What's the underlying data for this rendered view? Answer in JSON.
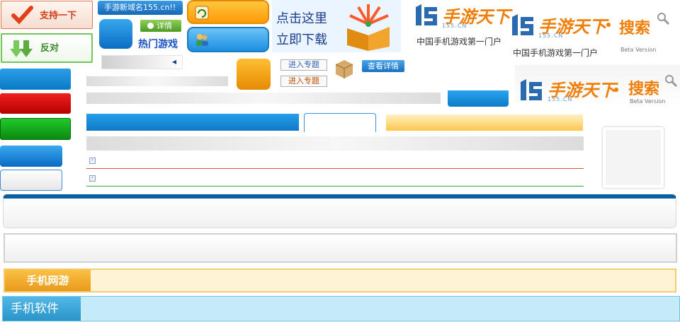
{
  "votes": {
    "support_label": "支持一下",
    "oppose_label": "反对"
  },
  "promo": {
    "domain_text": "手游新域名155.cn!!",
    "detail_label": "详情",
    "hot_games_label": "热门游戏",
    "download_line1": "点击这里",
    "download_line2": "立即下载"
  },
  "topics": {
    "enter_topic_1": "进入专题",
    "enter_topic_2": "进入专题",
    "view_detail": "查看详情"
  },
  "brand": {
    "logo_main": "手游天下",
    "logo_domain": "155.CN",
    "portal_caption": "中国手机游戏第一门户",
    "search_label": "搜索",
    "beta_label": "Beta Version"
  },
  "categories": {
    "mobile_online_games": "手机网游",
    "mobile_software": "手机软件"
  },
  "colors": {
    "accent_blue": "#1079c9",
    "accent_orange": "#f07f0a",
    "success_green": "#0a8a10",
    "danger_red": "#b50000"
  },
  "icons": [
    "checkmark-icon",
    "down-arrows-icon",
    "refresh-icon",
    "users-icon",
    "gift-box-icon",
    "search-magnifier-icon",
    "triangle-left-icon",
    "list-bullet-icon"
  ]
}
